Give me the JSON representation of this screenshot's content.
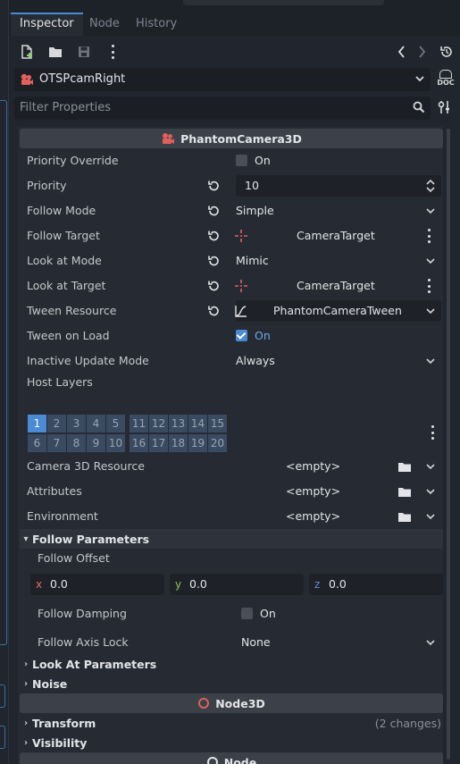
{
  "tabs": [
    "Inspector",
    "Node",
    "History"
  ],
  "object_selector": {
    "name": "OTSPcamRight"
  },
  "doc_button": {
    "line1": "D",
    "line2": "DOC"
  },
  "filter": {
    "placeholder": "Filter Properties"
  },
  "sections": {
    "phantom_camera": "PhantomCamera3D",
    "node3d": "Node3D",
    "node": "Node"
  },
  "properties": {
    "priority_override": {
      "label": "Priority Override",
      "value": "On",
      "checked": false
    },
    "priority": {
      "label": "Priority",
      "value": "10"
    },
    "follow_mode": {
      "label": "Follow Mode",
      "value": "Simple"
    },
    "follow_target": {
      "label": "Follow Target",
      "value": "CameraTarget"
    },
    "look_at_mode": {
      "label": "Look at Mode",
      "value": "Mimic"
    },
    "look_at_target": {
      "label": "Look at Target",
      "value": "CameraTarget"
    },
    "tween_resource": {
      "label": "Tween Resource",
      "value": "PhantomCameraTween"
    },
    "tween_on_load": {
      "label": "Tween on Load",
      "value": "On",
      "checked": true
    },
    "inactive_update_mode": {
      "label": "Inactive Update Mode",
      "value": "Always"
    },
    "host_layers": {
      "label": "Host Layers",
      "row1": [
        "1",
        "2",
        "3",
        "4",
        "5",
        "11",
        "12",
        "13",
        "14",
        "15"
      ],
      "row2": [
        "6",
        "7",
        "8",
        "9",
        "10",
        "16",
        "17",
        "18",
        "19",
        "20"
      ],
      "selected": "1"
    },
    "camera_3d_resource": {
      "label": "Camera 3D Resource",
      "value": "<empty>"
    },
    "attributes": {
      "label": "Attributes",
      "value": "<empty>"
    },
    "environment": {
      "label": "Environment",
      "value": "<empty>"
    }
  },
  "follow_parameters": {
    "header": "Follow Parameters",
    "offset_label": "Follow Offset",
    "offset": {
      "x_label": "x",
      "x": "0.0",
      "y_label": "y",
      "y": "0.0",
      "z_label": "z",
      "z": "0.0"
    },
    "damping": {
      "label": "Follow Damping",
      "value": "On",
      "checked": false
    },
    "axis_lock": {
      "label": "Follow Axis Lock",
      "value": "None"
    }
  },
  "groups": {
    "look_at_parameters": "Look At Parameters",
    "noise": "Noise",
    "transform": "Transform",
    "transform_changes": "(2 changes)",
    "visibility": "Visibility"
  },
  "colors": {
    "accent": "#4b8bd6",
    "phantom_icon": "#e0605c",
    "node3d_icon": "#e0605c",
    "axis_x": "#e06c5c",
    "axis_y": "#8fc25c",
    "axis_z": "#5c8fe0"
  }
}
